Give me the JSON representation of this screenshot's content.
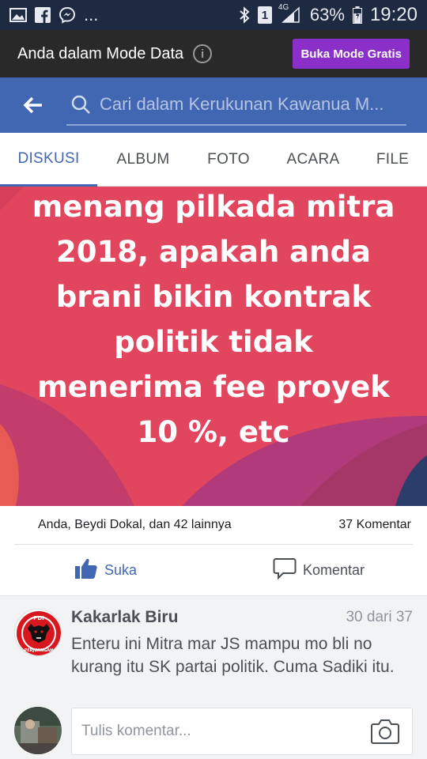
{
  "status_bar": {
    "icons_left": [
      "image-icon",
      "facebook-icon",
      "messenger-icon"
    ],
    "more": "...",
    "icons_right": [
      "bluetooth-icon",
      "sim-icon",
      "signal-icon",
      "battery-icon"
    ],
    "sim_label": "1",
    "network": "4G",
    "battery": "63%",
    "time": "19:20"
  },
  "banner": {
    "text": "Anda dalam Mode Data",
    "info_icon": "i",
    "button": "Buka Mode Gratis"
  },
  "search": {
    "placeholder": "Cari dalam Kerukunan Kawanua M..."
  },
  "tabs": [
    {
      "label": "DISKUSI",
      "active": true
    },
    {
      "label": "ALBUM",
      "active": false
    },
    {
      "label": "FOTO",
      "active": false
    },
    {
      "label": "ACARA",
      "active": false
    },
    {
      "label": "FILE",
      "active": false
    }
  ],
  "post": {
    "lines": [
      "menang pilkada mitra",
      "2018, apakah anda",
      "brani bikin kontrak",
      "politik tidak",
      "menerima fee proyek",
      "10 %, etc"
    ],
    "colors": {
      "primary": "#e2465e",
      "secondary": "#b13a7a",
      "accent": "#2b3d6b"
    }
  },
  "reactions": {
    "summary": "Anda, Beydi Dokal, dan 42 lainnya",
    "comments": "37 Komentar"
  },
  "actions": {
    "like": "Suka",
    "comment": "Komentar"
  },
  "comment": {
    "author": "Kakarlak Biru",
    "position": "30 dari 37",
    "text": "Enteru ini Mitra mar JS mampu mo bli no kurang itu SK partai politik. Cuma Sadiki itu.",
    "avatar_text_top": "PDI",
    "avatar_text_bottom": "PERJUANGAN"
  },
  "composer": {
    "placeholder": "Tulis komentar..."
  },
  "theme": {
    "facebook_blue": "#4267b2",
    "button_purple": "#8b2fc9",
    "status_bar": "#1e2a42"
  }
}
